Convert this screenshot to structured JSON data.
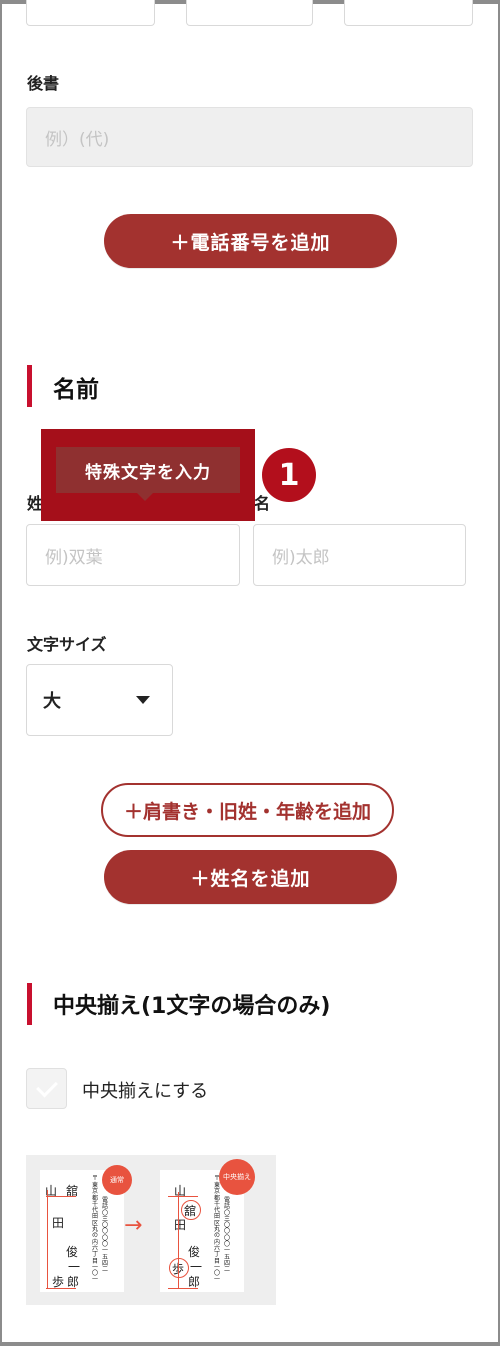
{
  "colors": {
    "accent": "#a3322f",
    "section_bar": "#c8102e",
    "tooltip_highlight": "#a50f1a"
  },
  "suffix": {
    "label": "後書",
    "placeholder": "例）(代)"
  },
  "add_phone_label": "＋電話番号を追加",
  "name_section": {
    "title": "名前",
    "special_char_label": "特殊文字を入力",
    "step_badge": "1",
    "last_name_label": "姓",
    "first_name_label": "名",
    "last_name_placeholder": "例)双葉",
    "first_name_placeholder": "例)太郎",
    "size_label": "文字サイズ",
    "size_value": "大",
    "add_extra_label": "＋肩書き・旧姓・年齢を追加",
    "add_name_label": "＋姓名を追加"
  },
  "center_section": {
    "title": "中央揃え(1文字の場合のみ)",
    "checkbox_label": "中央揃えにする",
    "preview": {
      "normal_badge": "通常",
      "center_badge": "中央揃え",
      "arrow": "→",
      "name_chars": [
        "山",
        "田",
        "俊",
        "一",
        "郎"
      ],
      "extra_chars": [
        "舘",
        "歩"
      ],
      "address_text": "東京都千代田区丸の内六丁目一〇一",
      "phone_text": "電話〇三〇〇〇〇一五四二",
      "postal_mark": "〒"
    }
  }
}
